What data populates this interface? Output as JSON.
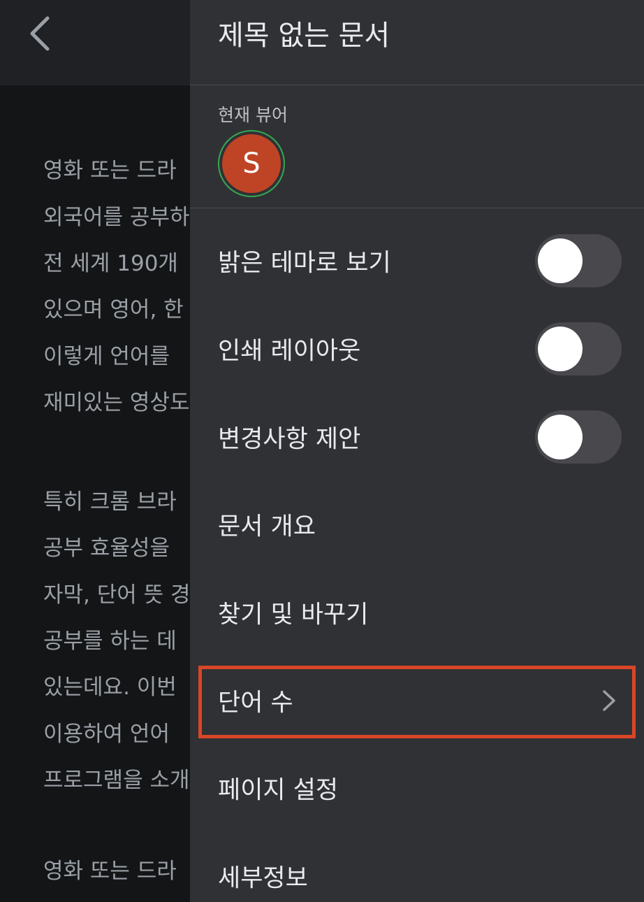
{
  "document": {
    "lines": [
      "영화 또는 드라",
      "외국어를 공부하",
      "전 세계 190개",
      "있으며 영어, 한",
      "이렇게 언어를",
      "재미있는 영상도",
      "특히 크롬 브라",
      "공부 효율성을",
      "자막, 단어 뜻 경",
      "공부를 하는 데",
      "있는데요. 이번",
      "이용하여 언어",
      "프로그램을 소개",
      "영화 또는 드라"
    ]
  },
  "drawer": {
    "title": "제목 없는 문서",
    "viewers_label": "현재 뷰어",
    "viewer_initial": "S",
    "items": [
      {
        "label": "밝은 테마로 보기",
        "control": "toggle",
        "on": false
      },
      {
        "label": "인쇄 레이아웃",
        "control": "toggle",
        "on": false
      },
      {
        "label": "변경사항 제안",
        "control": "toggle",
        "on": false
      },
      {
        "label": "문서 개요"
      },
      {
        "label": "찾기 및 바꾸기"
      },
      {
        "label": "단어 수",
        "control": "chevron",
        "highlighted": true
      },
      {
        "label": "페이지 설정"
      },
      {
        "label": "세부정보"
      }
    ]
  },
  "colors": {
    "drawer_background": "#303134",
    "avatar": "#bf4426",
    "avatar_ring": "#34a853",
    "highlight": "#d94627"
  }
}
